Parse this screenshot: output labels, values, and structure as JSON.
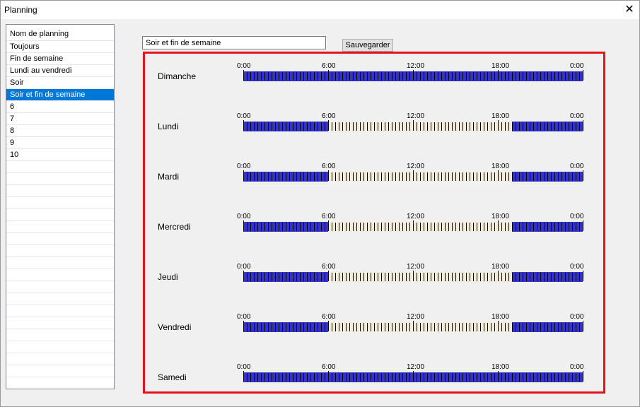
{
  "window": {
    "title": "Planning",
    "close_glyph": "✕"
  },
  "planning_list": {
    "header": "Nom de planning",
    "items": [
      "Toujours",
      "Fin de semaine",
      "Lundi au vendredi",
      "Soir",
      "Soir et fin de semaine",
      "6",
      "7",
      "8",
      "9",
      "10"
    ],
    "selected_index": 4,
    "empty_rows": 19
  },
  "editor": {
    "name_value": "Soir et fin de semaine",
    "save_label": "Sauvegarder"
  },
  "schedule": {
    "time_labels": [
      "0:00",
      "6:00",
      "12:00",
      "18:00",
      "0:00"
    ],
    "slots_per_day": 96,
    "active_color": "#3333cc",
    "inactive_color": "#f2ecd8",
    "tick_color": "#000000",
    "border_color": "#e3141e",
    "days": [
      {
        "name": "Dimanche",
        "active_ranges_hours": [
          [
            0,
            24
          ]
        ]
      },
      {
        "name": "Lundi",
        "active_ranges_hours": [
          [
            0,
            6
          ],
          [
            19,
            24
          ]
        ]
      },
      {
        "name": "Mardi",
        "active_ranges_hours": [
          [
            0,
            6
          ],
          [
            19,
            24
          ]
        ]
      },
      {
        "name": "Mercredi",
        "active_ranges_hours": [
          [
            0,
            6
          ],
          [
            19,
            24
          ]
        ]
      },
      {
        "name": "Jeudi",
        "active_ranges_hours": [
          [
            0,
            6
          ],
          [
            19,
            24
          ]
        ]
      },
      {
        "name": "Vendredi",
        "active_ranges_hours": [
          [
            0,
            6
          ],
          [
            19,
            24
          ]
        ]
      },
      {
        "name": "Samedi",
        "active_ranges_hours": [
          [
            0,
            24
          ]
        ]
      }
    ]
  }
}
